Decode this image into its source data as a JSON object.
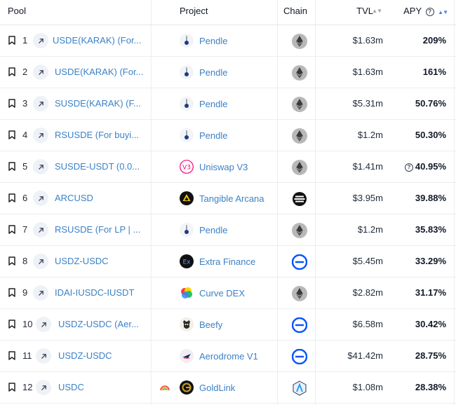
{
  "header": {
    "pool": "Pool",
    "project": "Project",
    "chain": "Chain",
    "tvl": "TVL",
    "apy": "APY",
    "sort_glyph": "▲▼",
    "help_glyph": "?"
  },
  "colors": {
    "link": "#3b82c6",
    "pendle": "#1e3a8a",
    "ethereum_bg": "#b3b3b3",
    "base_blue": "#0052ff",
    "sort_active": "#3b82f6"
  },
  "rows": [
    {
      "rank": "1",
      "pool": "USDE(KARAK) (For...",
      "project": "Pendle",
      "project_icon": "pendle-icon",
      "chain_icon": "ethereum-icon",
      "tvl": "$1.63m",
      "apy": "209%",
      "apy_help": false
    },
    {
      "rank": "2",
      "pool": "USDE(KARAK) (For...",
      "project": "Pendle",
      "project_icon": "pendle-icon",
      "chain_icon": "ethereum-icon",
      "tvl": "$1.63m",
      "apy": "161%",
      "apy_help": false
    },
    {
      "rank": "3",
      "pool": "SUSDE(KARAK) (F...",
      "project": "Pendle",
      "project_icon": "pendle-icon",
      "chain_icon": "ethereum-icon",
      "tvl": "$5.31m",
      "apy": "50.76%",
      "apy_help": false
    },
    {
      "rank": "4",
      "pool": "RSUSDE (For buyi...",
      "project": "Pendle",
      "project_icon": "pendle-icon",
      "chain_icon": "ethereum-icon",
      "tvl": "$1.2m",
      "apy": "50.30%",
      "apy_help": false
    },
    {
      "rank": "5",
      "pool": "SUSDE-USDT (0.0...",
      "project": "Uniswap V3",
      "project_icon": "uniswap-icon",
      "chain_icon": "ethereum-icon",
      "tvl": "$1.41m",
      "apy": "40.95%",
      "apy_help": true
    },
    {
      "rank": "6",
      "pool": "ARCUSD",
      "project": "Tangible Arcana",
      "project_icon": "tangible-icon",
      "chain_icon": "real-chain-icon",
      "tvl": "$3.95m",
      "apy": "39.88%",
      "apy_help": false
    },
    {
      "rank": "7",
      "pool": "RSUSDE (For LP | ...",
      "project": "Pendle",
      "project_icon": "pendle-icon",
      "chain_icon": "ethereum-icon",
      "tvl": "$1.2m",
      "apy": "35.83%",
      "apy_help": false
    },
    {
      "rank": "8",
      "pool": "USDZ-USDC",
      "project": "Extra Finance",
      "project_icon": "extra-finance-icon",
      "chain_icon": "base-icon",
      "tvl": "$5.45m",
      "apy": "33.29%",
      "apy_help": false
    },
    {
      "rank": "9",
      "pool": "IDAI-IUSDC-IUSDT",
      "project": "Curve DEX",
      "project_icon": "curve-icon",
      "chain_icon": "ethereum-icon",
      "tvl": "$2.82m",
      "apy": "31.17%",
      "apy_help": false
    },
    {
      "rank": "10",
      "pool": "USDZ-USDC (Aer...",
      "project": "Beefy",
      "project_icon": "beefy-icon",
      "chain_icon": "base-icon",
      "tvl": "$6.58m",
      "apy": "30.42%",
      "apy_help": false
    },
    {
      "rank": "11",
      "pool": "USDZ-USDC",
      "project": "Aerodrome V1",
      "project_icon": "aerodrome-icon",
      "chain_icon": "base-icon",
      "tvl": "$41.42m",
      "apy": "28.75%",
      "apy_help": false
    },
    {
      "rank": "12",
      "pool": "USDC",
      "project": "GoldLink",
      "project_icon": "goldlink-icon",
      "chain_icon": "arbitrum-icon",
      "tvl": "$1.08m",
      "apy": "28.38%",
      "apy_help": false,
      "extra_icon": "rainbow-icon"
    }
  ]
}
